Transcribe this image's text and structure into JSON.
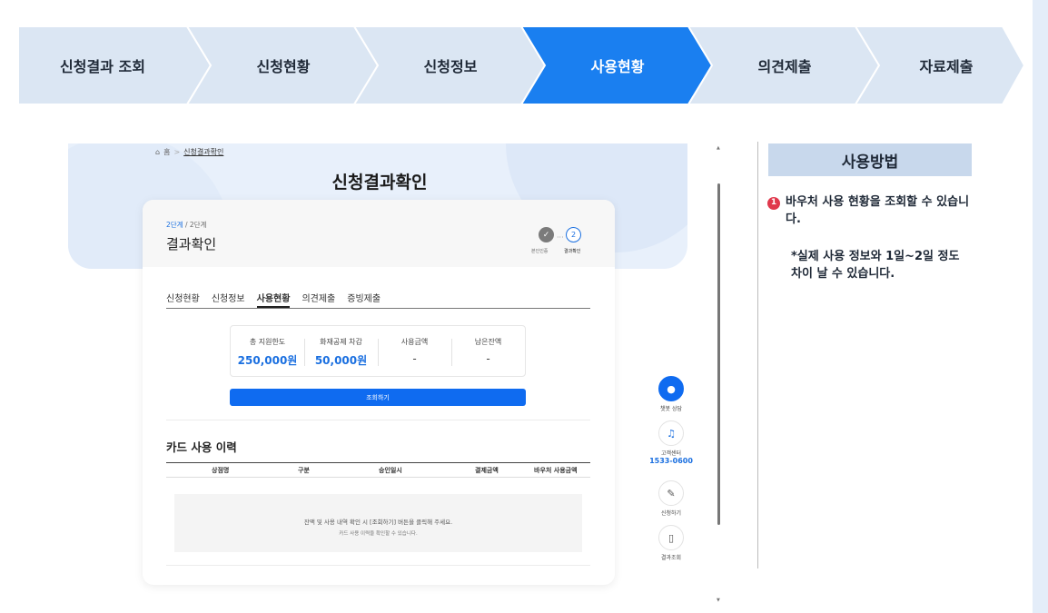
{
  "steps": [
    {
      "label": "신청결과 조회",
      "active": false
    },
    {
      "label": "신청현황",
      "active": false
    },
    {
      "label": "신청정보",
      "active": false
    },
    {
      "label": "사용현황",
      "active": true
    },
    {
      "label": "의견제출",
      "active": false
    },
    {
      "label": "자료제출",
      "active": false
    }
  ],
  "colors": {
    "step_bg": "#dbe6f3",
    "step_active": "#1a7ff0",
    "accent": "#1a6fe0"
  },
  "breadcrumb": {
    "home": "홈",
    "separator": ">",
    "current": "신청결과확인"
  },
  "page_title": "신청결과확인",
  "card": {
    "step_current": "2단계",
    "step_total": "/ 2단계",
    "title": "결과확인",
    "progress": {
      "done_mark": "✓",
      "current_num": "2",
      "label1": "본인인증",
      "label2": "결과확인"
    },
    "tabs": [
      "신청현황",
      "신청정보",
      "사용현황",
      "의견제출",
      "증빙제출"
    ],
    "active_tab": "사용현황",
    "summary": [
      {
        "label": "총 지원한도",
        "value": "250,000원"
      },
      {
        "label": "화재공제 차감",
        "value": "50,000원"
      },
      {
        "label": "사용금액",
        "value": "-"
      },
      {
        "label": "남은잔액",
        "value": "-"
      }
    ],
    "query_button": "조회하기",
    "history_title": "카드 사용 이력",
    "table_headers": [
      "상점명",
      "구분",
      "승인일시",
      "결제금액",
      "바우처 사용금액"
    ],
    "empty_line1": "잔액 및 사용 내역 확인 시 [조회하기] 버튼을 클릭해 주세요.",
    "empty_line2": "카드 사용 이력을 확인할 수 있습니다."
  },
  "side_buttons": {
    "chatbot": "챗봇 상담",
    "center": "고객센터",
    "phone": "1533-0600",
    "apply": "신청하기",
    "result": "결과조회"
  },
  "how_to": {
    "title": "사용방법",
    "item_num": "1",
    "item_text": "바우처 사용 현황을 조회할 수 있습니다.",
    "note": "*실제 사용 정보와 1일~2일 정도 차이 날 수 있습니다."
  }
}
